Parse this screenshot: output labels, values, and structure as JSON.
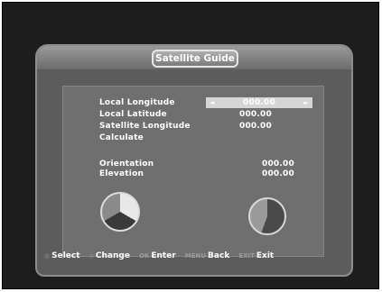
{
  "header": {
    "title": "Satellite Guide"
  },
  "fields": [
    {
      "label": "Local Longitude",
      "value": "000.00",
      "left_arrow": "◄",
      "right_arrow": "►"
    },
    {
      "label": "Local Latitude",
      "value": "000.00"
    },
    {
      "label": "Satellite Longitude",
      "value": "000.00"
    },
    {
      "label": "Calculate"
    }
  ],
  "results": [
    {
      "label": "Orientation",
      "value": "000.00"
    },
    {
      "label": "Elevation",
      "value": "000.00"
    }
  ],
  "footer": [
    {
      "key": "◎",
      "label": "Select"
    },
    {
      "key": "◇",
      "label": "Change"
    },
    {
      "key": "OK",
      "label": "Enter"
    },
    {
      "key": "MENU",
      "label": "Back"
    },
    {
      "key": "EXIT",
      "label": "Exit"
    }
  ],
  "icons": {
    "orientation": "compass-dial-icon",
    "elevation": "satellite-dish-icon"
  }
}
